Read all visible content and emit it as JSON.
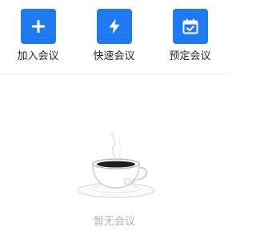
{
  "actions": [
    {
      "label": "加入会议",
      "icon": "plus-icon"
    },
    {
      "label": "快速会议",
      "icon": "lightning-icon"
    },
    {
      "label": "预定会议",
      "icon": "calendar-check-icon"
    }
  ],
  "empty_state": {
    "message": "暂无会议",
    "illustration": "coffee-cup-icon"
  },
  "colors": {
    "accent": "#1f7af2",
    "label_text": "#2a2a2a",
    "empty_text": "#b3b3b3",
    "divider": "#ececec"
  }
}
